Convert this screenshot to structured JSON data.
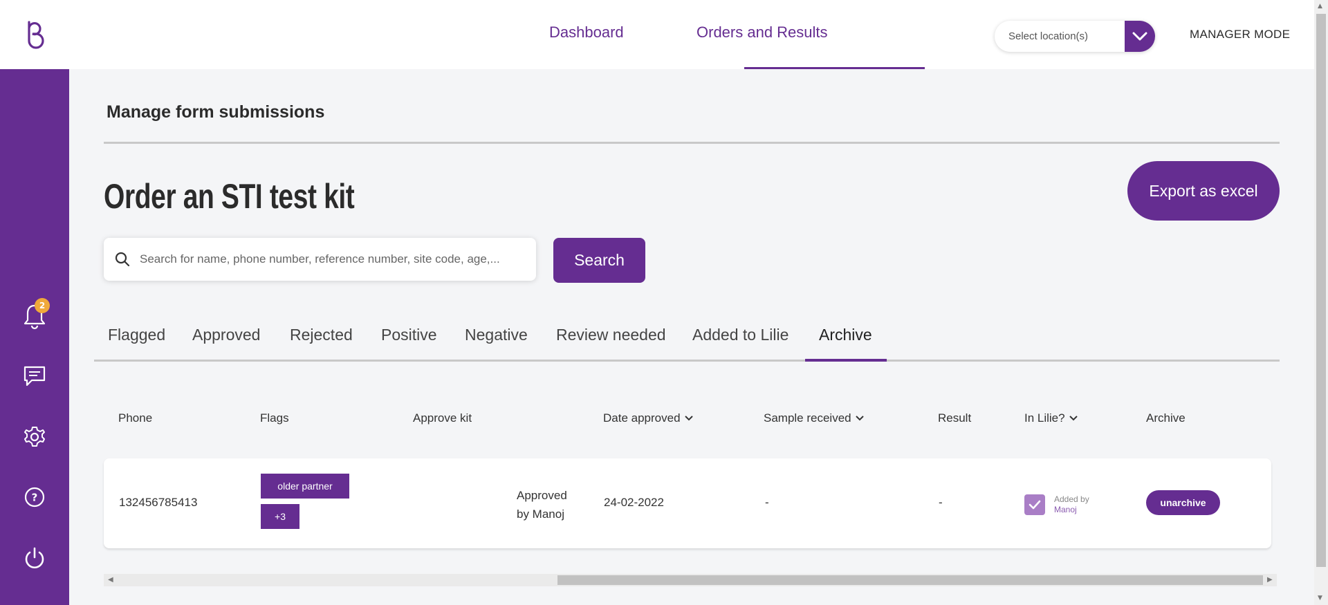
{
  "nav": {
    "tabs": [
      {
        "label": "Dashboard"
      },
      {
        "label": "Orders and Results"
      }
    ],
    "location_placeholder": "Select location(s)",
    "manager_mode": "MANAGER MODE"
  },
  "sidebar": {
    "notification_count": "2",
    "icons": [
      "logo-icon",
      "bell-icon",
      "chat-icon",
      "gear-icon",
      "help-icon",
      "power-icon"
    ]
  },
  "page": {
    "section_title": "Manage form submissions",
    "title": "Order an STI test kit",
    "export_label": "Export as excel",
    "search_placeholder": "Search for name, phone number, reference number, site code, age,...",
    "search_label": "Search"
  },
  "tabs": [
    {
      "label": "Flagged"
    },
    {
      "label": "Approved"
    },
    {
      "label": "Rejected"
    },
    {
      "label": "Positive"
    },
    {
      "label": "Negative"
    },
    {
      "label": "Review needed"
    },
    {
      "label": "Added to Lilie"
    },
    {
      "label": "Archive"
    }
  ],
  "active_tab": "Archive",
  "table": {
    "headers": {
      "phone": "Phone",
      "flags": "Flags",
      "approve_kit": "Approve kit",
      "date_approved": "Date approved",
      "sample_received": "Sample received",
      "result": "Result",
      "in_lilie": "In Lilie?",
      "archive": "Archive"
    },
    "rows": [
      {
        "phone": "132456785413",
        "flag_primary": "older partner",
        "flag_more": "+3",
        "approve_status": "Approved",
        "approve_by": "by Manoj",
        "date_approved": "24-02-2022",
        "sample_received": "-",
        "result": "-",
        "in_lilie_checked": true,
        "added_by_label": "Added by",
        "added_by_name": "Manoj",
        "archive_action": "unarchive"
      }
    ]
  },
  "colors": {
    "brand": "#652d91",
    "badge": "#f0a93a",
    "background": "#f4f5f7"
  }
}
